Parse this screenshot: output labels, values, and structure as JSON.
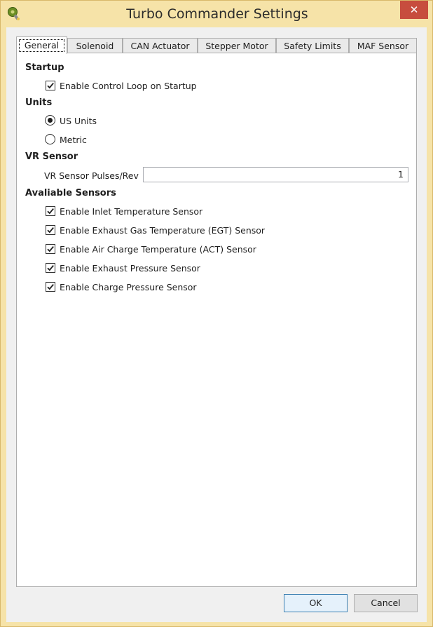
{
  "window": {
    "title": "Turbo Commander Settings",
    "close_glyph": "✕"
  },
  "tabs": [
    {
      "label": "General",
      "active": true
    },
    {
      "label": "Solenoid",
      "active": false
    },
    {
      "label": "CAN Actuator",
      "active": false
    },
    {
      "label": "Stepper Motor",
      "active": false
    },
    {
      "label": "Safety Limits",
      "active": false
    },
    {
      "label": "MAF Sensor",
      "active": false
    }
  ],
  "general": {
    "startup": {
      "title": "Startup",
      "enable_control_loop": {
        "label": "Enable Control Loop on Startup",
        "checked": true
      }
    },
    "units": {
      "title": "Units",
      "options": [
        {
          "label": "US Units",
          "selected": true
        },
        {
          "label": "Metric",
          "selected": false
        }
      ]
    },
    "vr_sensor": {
      "title": "VR Sensor",
      "pulses_label": "VR Sensor Pulses/Rev",
      "pulses_value": "1"
    },
    "sensors": {
      "title": "Avaliable Sensors",
      "items": [
        {
          "label": "Enable Inlet Temperature Sensor",
          "checked": true
        },
        {
          "label": "Enable Exhaust Gas Temperature (EGT) Sensor",
          "checked": true
        },
        {
          "label": "Enable Air Charge Temperature (ACT) Sensor",
          "checked": true
        },
        {
          "label": "Enable Exhaust Pressure Sensor",
          "checked": true
        },
        {
          "label": "Enable Charge Pressure Sensor",
          "checked": true
        }
      ]
    }
  },
  "buttons": {
    "ok": "OK",
    "cancel": "Cancel"
  },
  "colors": {
    "frame": "#f6e3a8",
    "close": "#c74d3e",
    "default_button_border": "#3c7fb1"
  },
  "icons": {
    "app": "turbo-app-icon",
    "close": "close-icon",
    "check": "checkmark-icon",
    "radio": "radio-dot-icon"
  }
}
